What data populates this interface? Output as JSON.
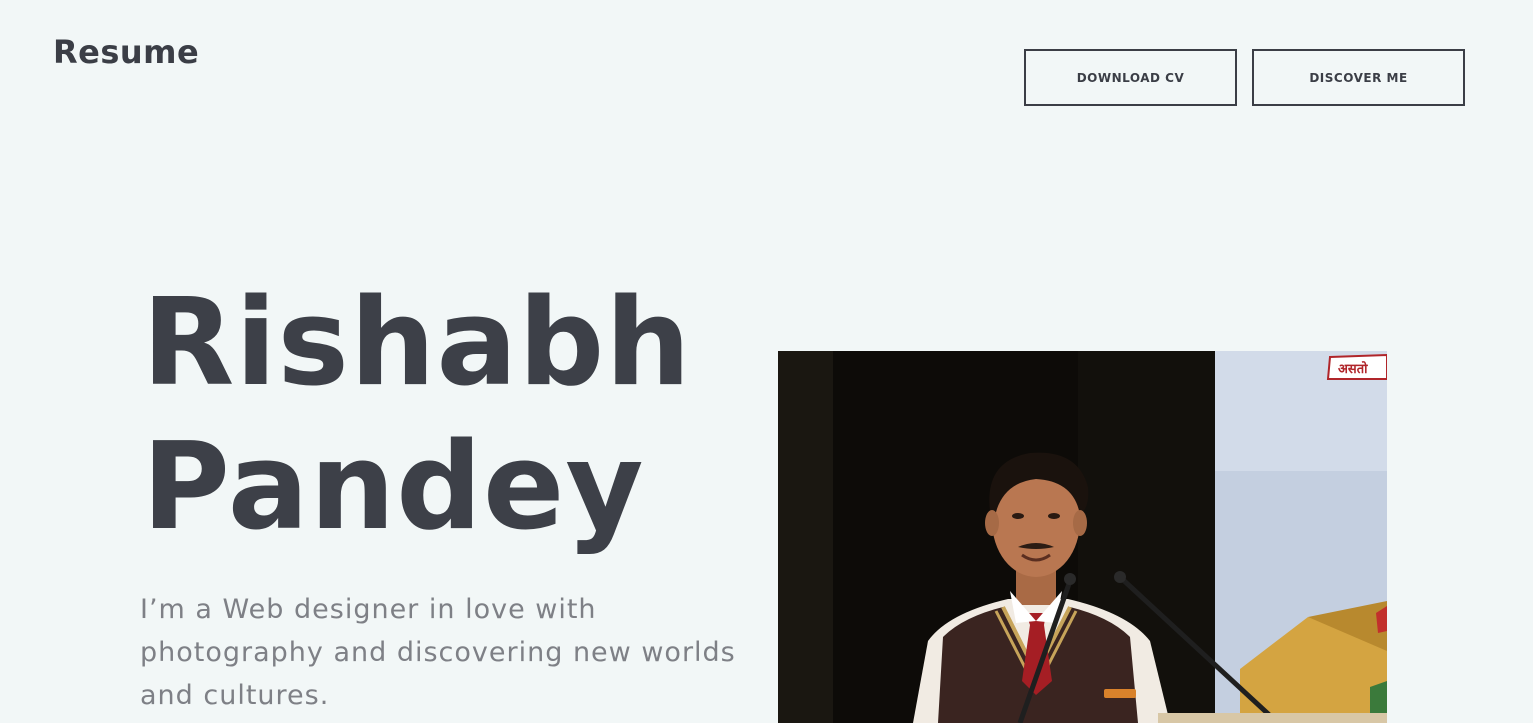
{
  "header": {
    "logo": "Resume",
    "buttons": {
      "download_cv": "DOWNLOAD CV",
      "discover_me": "DISCOVER ME"
    }
  },
  "hero": {
    "first_name": "Rishabh",
    "last_name": "Pandey",
    "tagline": "I’m a Web designer in love with photography and discovering new worlds and cultures.",
    "photo_sign_text": "असतो"
  },
  "colors": {
    "background": "#f2f7f7",
    "text_dark": "#3d4048",
    "text_muted": "#7e8086",
    "button_border": "#3b3e46"
  }
}
